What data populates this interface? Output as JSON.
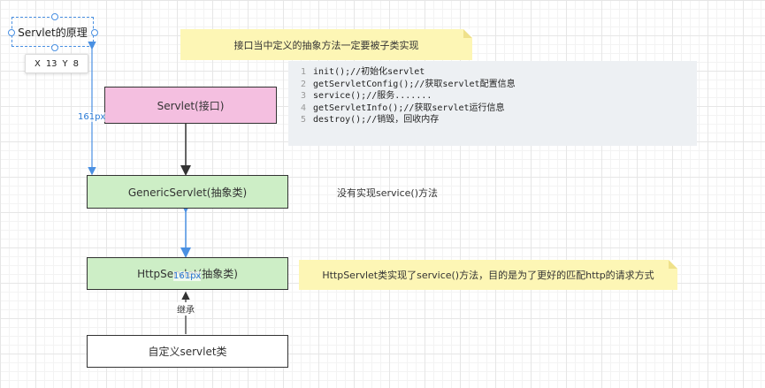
{
  "title_label": "Servlet的原理",
  "coords": {
    "x_label": "X",
    "x_value": "13",
    "y_label": "Y",
    "y_value": "8"
  },
  "notes": {
    "top": "接口当中定义的抽象方法一定要被子类实现",
    "right": "HttpServlet类实现了service()方法，目的是为了更好的匹配http的请求方式"
  },
  "code_lines": [
    {
      "num": "1",
      "text": "init();//初始化servlet"
    },
    {
      "num": "2",
      "text": "getServletConfig();//获取servlet配置信息"
    },
    {
      "num": "3",
      "text": "service();//服务......."
    },
    {
      "num": "4",
      "text": "getServletInfo();//获取servlet运行信息"
    },
    {
      "num": "5",
      "text": "destroy();//销毁，回收内存"
    }
  ],
  "boxes": {
    "servlet": "Servlet(接口)",
    "generic": "GenericServlet(抽象类)",
    "http": "HttpServlet(抽象类)",
    "custom": "自定义servlet类"
  },
  "side_text": "没有实现service()方法",
  "edge_labels": {
    "inherit": "继承",
    "measure_1": "161px",
    "measure_2": "161px"
  },
  "colors": {
    "interface": "#f4bfe0",
    "abstract": "#cdeec6",
    "note": "#fdf6b5",
    "guide": "#4a90e2"
  }
}
